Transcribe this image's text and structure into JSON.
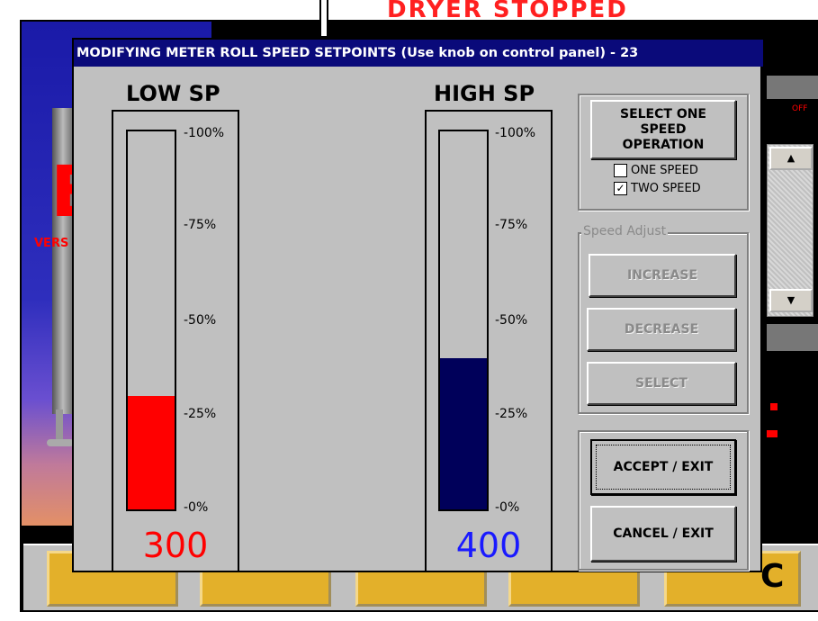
{
  "background": {
    "status_text": "DRYER STOPPED",
    "big_letter": "E",
    "version_label": "VERS",
    "off_label": "OFF",
    "scroll_up": "▲",
    "scroll_down": "▼",
    "bottom_letter": "C"
  },
  "dialog": {
    "title": "MODIFYING METER ROLL SPEED SETPOINTS (Use knob on control panel) - 23",
    "low_sp": {
      "label": "LOW SP",
      "value": "300",
      "percent": 0.3,
      "fill_color": "#ff0000",
      "value_color": "#ff0000"
    },
    "high_sp": {
      "label": "HIGH SP",
      "value": "400",
      "percent": 0.4,
      "fill_color": "#00005a",
      "value_color": "#1a1aff"
    },
    "ticks": [
      "-100%",
      "-75%",
      "-50%",
      "-25%",
      "-0%"
    ],
    "select_one_speed": "SELECT ONE SPEED OPERATION",
    "one_speed": {
      "label": "ONE SPEED",
      "checked": false
    },
    "two_speed": {
      "label": "TWO SPEED",
      "checked": true
    },
    "speed_adjust_legend": "Speed Adjust",
    "increase": "INCREASE",
    "decrease": "DECREASE",
    "select": "SELECT",
    "accept": "ACCEPT / EXIT",
    "cancel": "CANCEL / EXIT",
    "check_mark": "✓"
  }
}
